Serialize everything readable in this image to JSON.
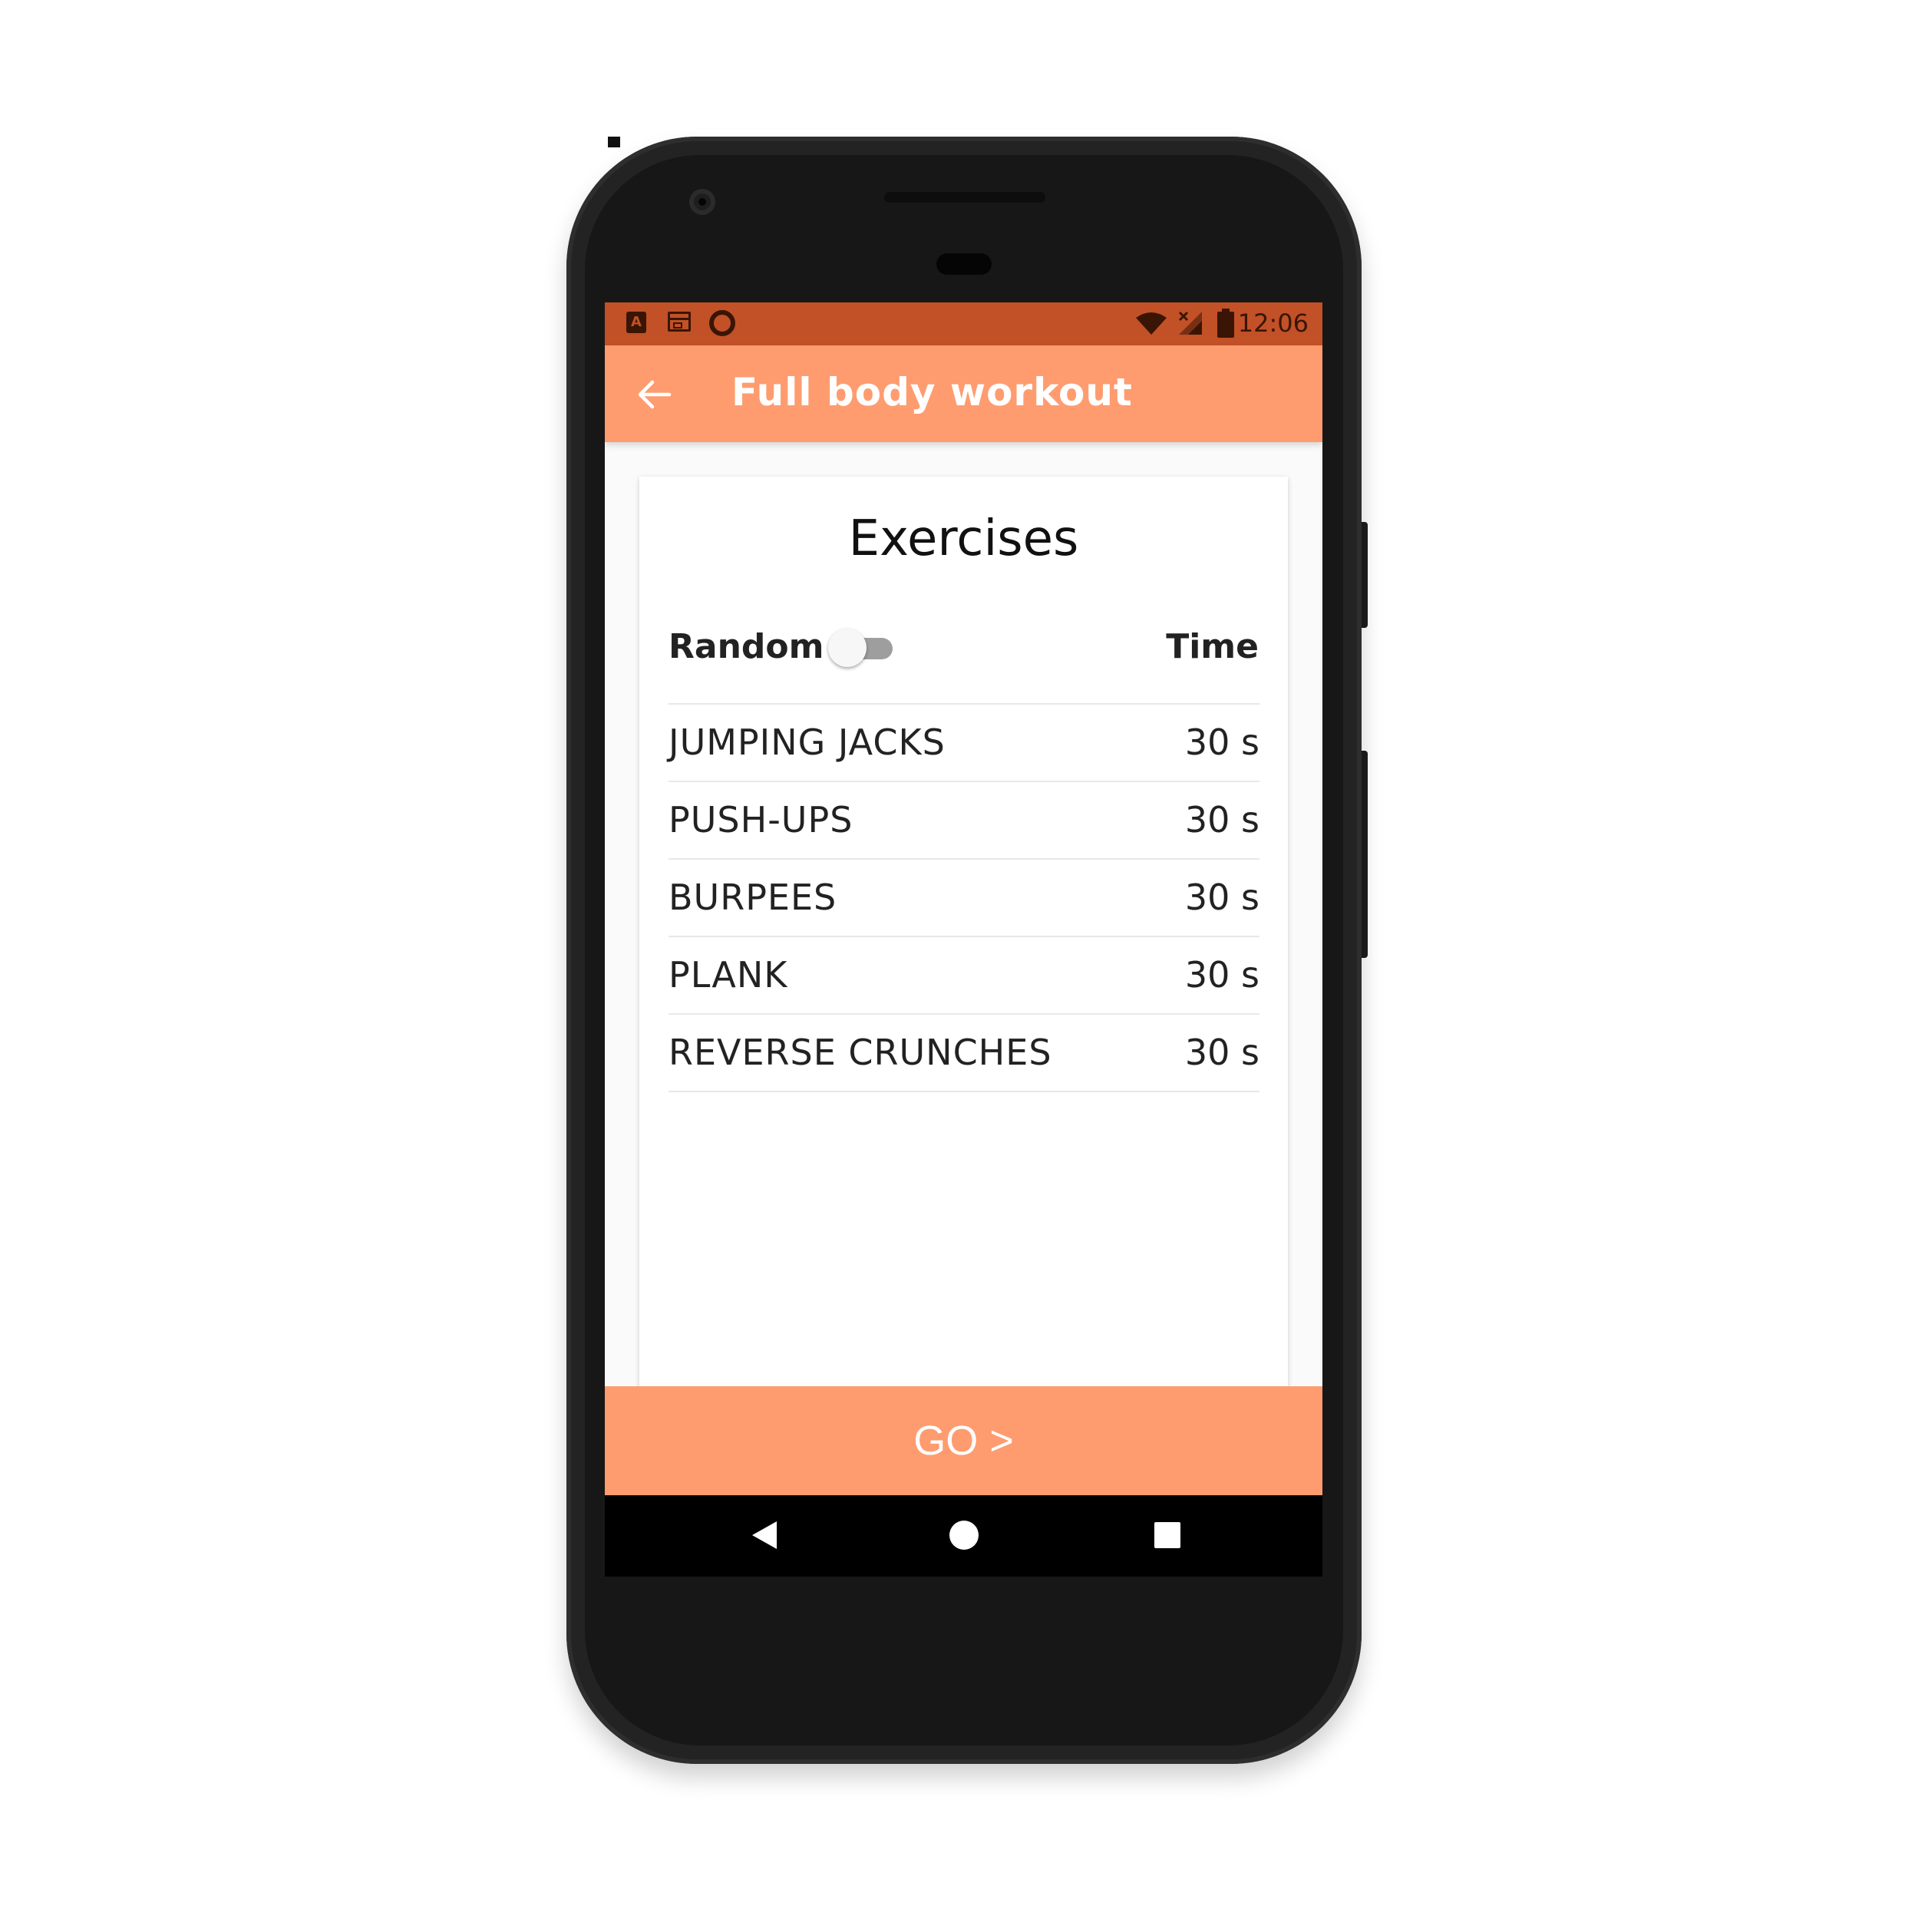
{
  "status_bar": {
    "time": "12:06",
    "left_icons": [
      "app-a-icon",
      "calendar-icon",
      "ring-icon"
    ],
    "right_icons": [
      "wifi-icon",
      "signal-icon",
      "battery-icon"
    ]
  },
  "app_bar": {
    "title": "Full body workout",
    "back_icon": "arrow-back-icon"
  },
  "card": {
    "title": "Exercises",
    "random_label": "Random",
    "random_enabled": false,
    "time_header": "Time",
    "exercises": [
      {
        "name": "JUMPING JACKS",
        "time": "30 s"
      },
      {
        "name": "PUSH-UPS",
        "time": "30 s"
      },
      {
        "name": "BURPEES",
        "time": "30 s"
      },
      {
        "name": "PLANK",
        "time": "30 s"
      },
      {
        "name": "REVERSE CRUNCHES",
        "time": "30 s"
      }
    ]
  },
  "go_button": {
    "label": "GO >"
  },
  "nav_bar": {
    "icons": [
      "nav-back-icon",
      "nav-home-icon",
      "nav-recents-icon"
    ]
  },
  "colors": {
    "status_bar": "#c25127",
    "accent": "#fe9c70",
    "card_bg": "#ffffff",
    "toggle_track": "#9e9e9e"
  }
}
